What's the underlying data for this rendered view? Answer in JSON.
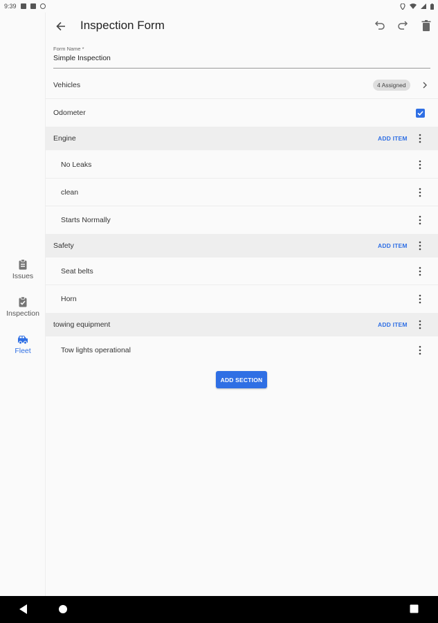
{
  "status_bar": {
    "time": "9:39"
  },
  "rail": {
    "items": [
      {
        "label": "Issues",
        "icon": "clipboard-icon",
        "active": false
      },
      {
        "label": "Inspection",
        "icon": "clipboard-check-icon",
        "active": false
      },
      {
        "label": "Fleet",
        "icon": "car-icon",
        "active": true
      }
    ]
  },
  "app_bar": {
    "title": "Inspection Form"
  },
  "form_name": {
    "label": "Form Name *",
    "value": "Simple Inspection"
  },
  "vehicles": {
    "label": "Vehicles",
    "badge": "4 Assigned"
  },
  "odometer": {
    "label": "Odometer",
    "checked": true
  },
  "sections": [
    {
      "name": "Engine",
      "action": "ADD ITEM",
      "items": [
        "No Leaks",
        "clean",
        "Starts Normally"
      ]
    },
    {
      "name": "Safety",
      "action": "ADD ITEM",
      "items": [
        "Seat belts",
        "Horn"
      ]
    },
    {
      "name": "towing equipment",
      "action": "ADD ITEM",
      "items": [
        "Tow lights operational"
      ]
    }
  ],
  "add_section_label": "ADD SECTION",
  "colors": {
    "accent": "#2f6fe4",
    "section_bg": "#eeeeee",
    "background": "#fafafa"
  }
}
